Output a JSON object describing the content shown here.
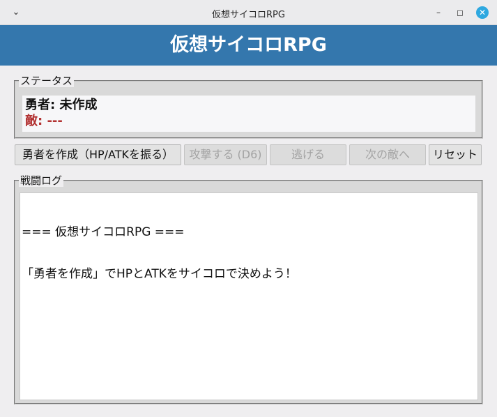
{
  "window": {
    "title": "仮想サイコロRPG",
    "menu_icon": "chevron-down-icon",
    "minimize_icon": "minimize-icon",
    "maximize_icon": "maximize-icon",
    "close_icon": "close-icon"
  },
  "header": {
    "title": "仮想サイコロRPG",
    "background": "#3477ad"
  },
  "status": {
    "legend": "ステータス",
    "hero": "勇者: 未作成",
    "enemy": "敵: ---",
    "enemy_color": "#b23131"
  },
  "actions": {
    "create": {
      "label": "勇者を作成（HP/ATKを振る）",
      "enabled": true
    },
    "attack": {
      "label": "攻撃する (D6)",
      "enabled": false
    },
    "flee": {
      "label": "逃げる",
      "enabled": false
    },
    "next_enemy": {
      "label": "次の敵へ",
      "enabled": false
    },
    "reset": {
      "label": "リセット",
      "enabled": true
    }
  },
  "log": {
    "legend": "戦闘ログ",
    "lines": [
      "=== 仮想サイコロRPG ===",
      "「勇者を作成」でHPとATKをサイコロで決めよう！"
    ]
  }
}
